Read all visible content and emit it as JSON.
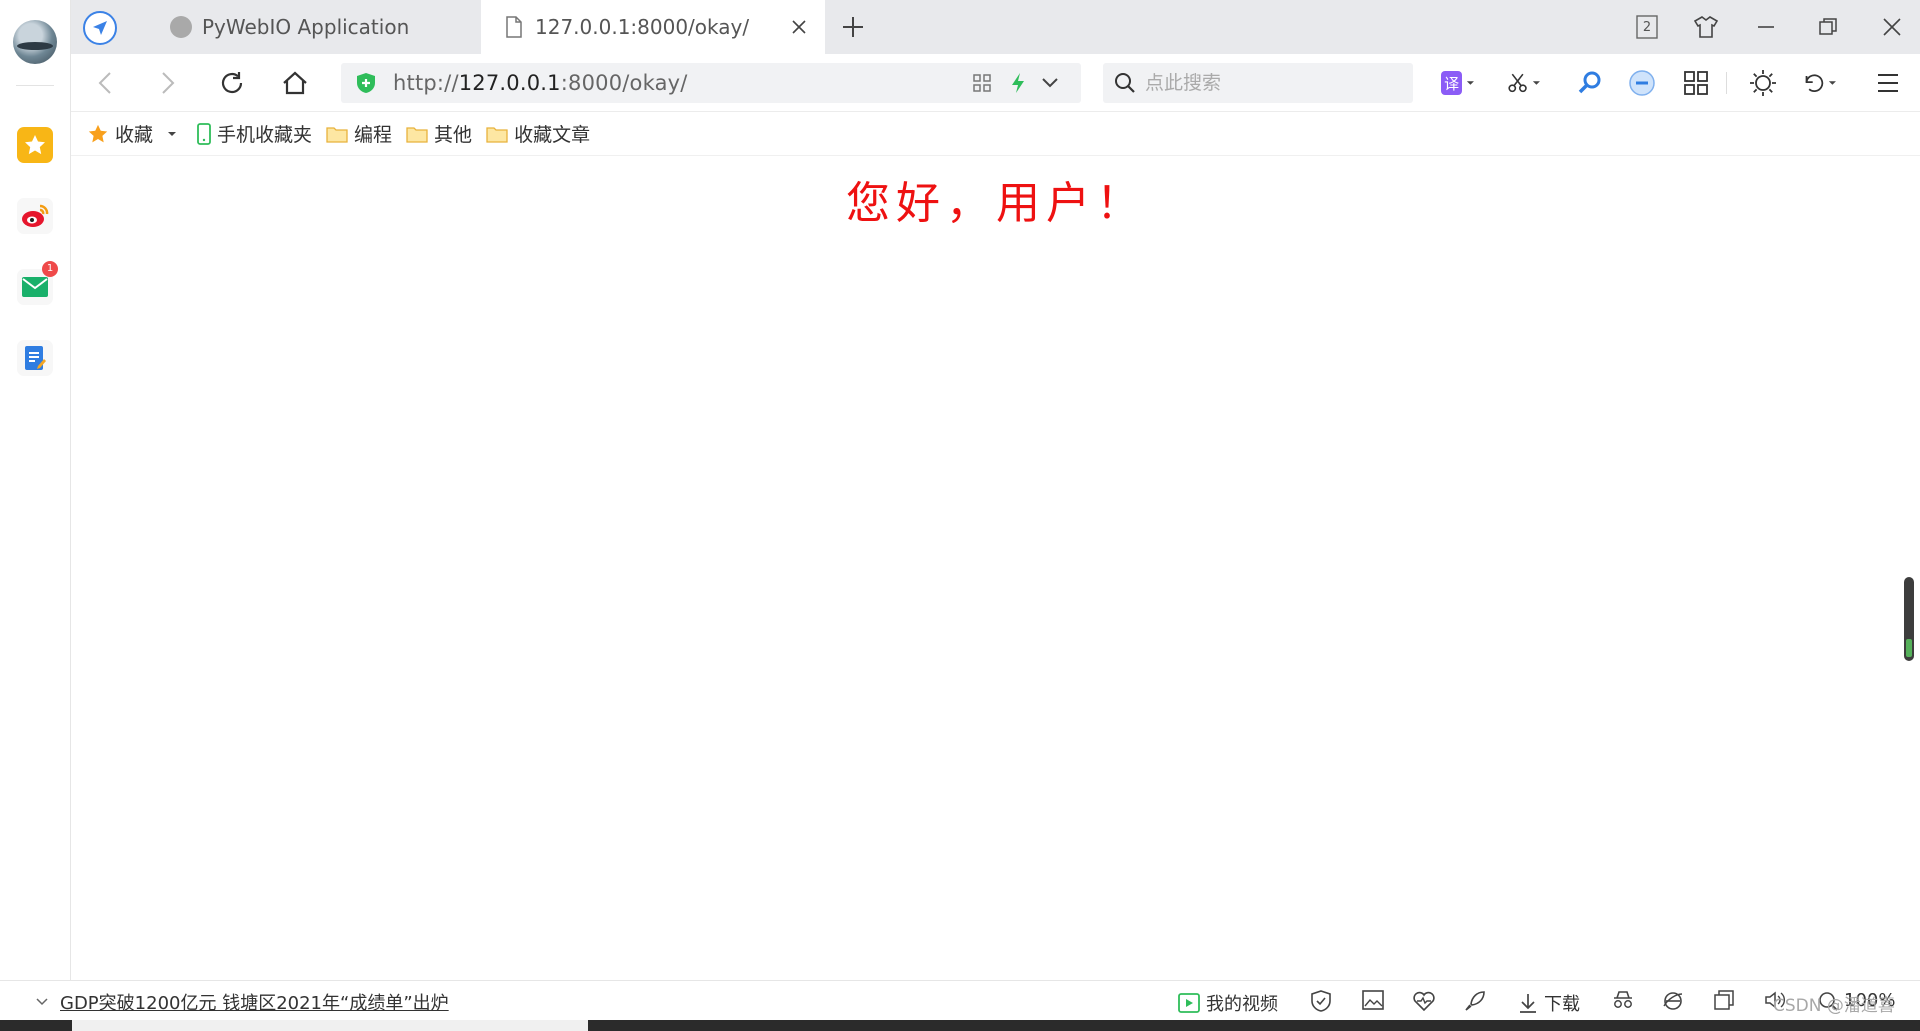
{
  "browser": {
    "tabs": [
      {
        "title": "PyWebIO Application"
      },
      {
        "title": "127.0.0.1:8000/okay/"
      }
    ],
    "tab_count_badge": "2",
    "address": {
      "scheme": "http://",
      "host": "127.0.0.1",
      "rest": ":8000/okay/"
    },
    "search_placeholder": "点此搜索",
    "translate_label": "译"
  },
  "sidebar": {
    "mail_badge": "1"
  },
  "bookmarks": [
    {
      "label": "收藏",
      "icon": "star-icon"
    },
    {
      "label": "手机收藏夹",
      "icon": "phone-icon"
    },
    {
      "label": "编程",
      "icon": "folder-icon"
    },
    {
      "label": "其他",
      "icon": "folder-icon"
    },
    {
      "label": "收藏文章",
      "icon": "folder-icon"
    }
  ],
  "page": {
    "greeting": "您好，用户！",
    "greeting_color": "#ee1111"
  },
  "statusbar": {
    "news": "GDP突破1200亿元 钱塘区2021年“成绩单”出炉",
    "video_label": "我的视频",
    "download_label": "下载",
    "zoom": "100%",
    "watermark": "CSDN @潘道喜"
  },
  "colors": {
    "accent": "#3b82e6",
    "star": "#f8b616",
    "secure": "#2fbd5a"
  }
}
